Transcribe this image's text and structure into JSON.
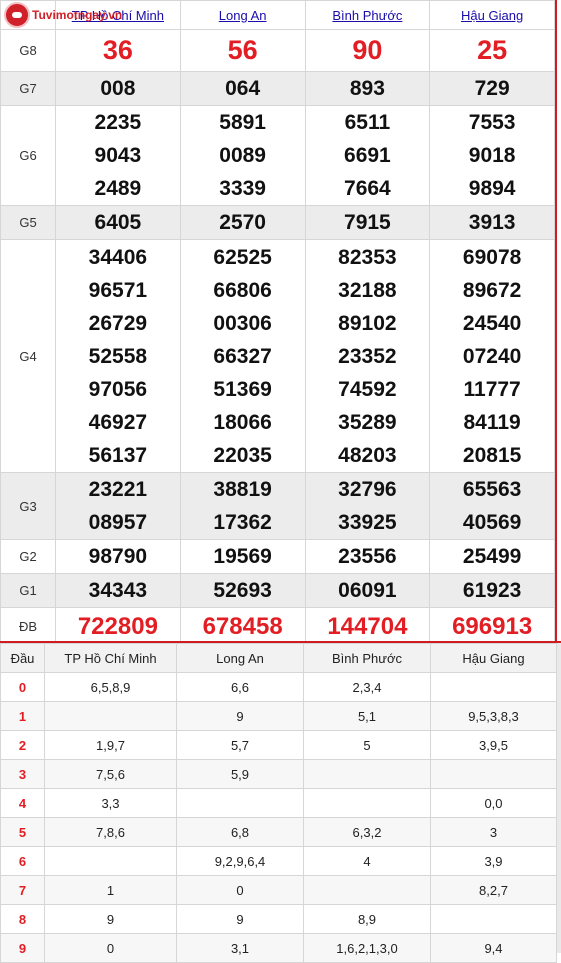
{
  "logo": {
    "text": "Tuvimotngay.vn"
  },
  "provinces": [
    "TP Hồ Chí Minh",
    "Long An",
    "Bình Phước",
    "Hậu Giang"
  ],
  "prize_labels": {
    "g8": "G8",
    "g7": "G7",
    "g6": "G6",
    "g5": "G5",
    "g4": "G4",
    "g3": "G3",
    "g2": "G2",
    "g1": "G1",
    "db": "ĐB"
  },
  "results": {
    "g8": [
      "36",
      "56",
      "90",
      "25"
    ],
    "g7": [
      "008",
      "064",
      "893",
      "729"
    ],
    "g6": [
      [
        "2235",
        "9043",
        "2489"
      ],
      [
        "5891",
        "0089",
        "3339"
      ],
      [
        "6511",
        "6691",
        "7664"
      ],
      [
        "7553",
        "9018",
        "9894"
      ]
    ],
    "g5": [
      "6405",
      "2570",
      "7915",
      "3913"
    ],
    "g4": [
      [
        "34406",
        "96571",
        "26729",
        "52558",
        "97056",
        "46927",
        "56137"
      ],
      [
        "62525",
        "66806",
        "00306",
        "66327",
        "51369",
        "18066",
        "22035"
      ],
      [
        "82353",
        "32188",
        "89102",
        "23352",
        "74592",
        "35289",
        "48203"
      ],
      [
        "69078",
        "89672",
        "24540",
        "07240",
        "11777",
        "84119",
        "20815"
      ]
    ],
    "g3": [
      [
        "23221",
        "08957"
      ],
      [
        "38819",
        "17362"
      ],
      [
        "32796",
        "33925"
      ],
      [
        "65563",
        "40569"
      ]
    ],
    "g2": [
      "98790",
      "19569",
      "23556",
      "25499"
    ],
    "g1": [
      "34343",
      "52693",
      "06091",
      "61923"
    ],
    "db": [
      "722809",
      "678458",
      "144704",
      "696913"
    ]
  },
  "loto": {
    "head_label": "Đầu",
    "columns": [
      "TP Hồ Chí Minh",
      "Long An",
      "Bình Phước",
      "Hậu Giang"
    ],
    "rows": [
      {
        "head": "0",
        "values": [
          "6,5,8,9",
          "6,6",
          "2,3,4",
          ""
        ]
      },
      {
        "head": "1",
        "values": [
          "",
          "9",
          "5,1",
          "9,5,3,8,3"
        ]
      },
      {
        "head": "2",
        "values": [
          "1,9,7",
          "5,7",
          "5",
          "3,9,5"
        ]
      },
      {
        "head": "3",
        "values": [
          "7,5,6",
          "5,9",
          "",
          ""
        ]
      },
      {
        "head": "4",
        "values": [
          "3,3",
          "",
          "",
          "0,0"
        ]
      },
      {
        "head": "5",
        "values": [
          "7,8,6",
          "6,8",
          "6,3,2",
          "3"
        ]
      },
      {
        "head": "6",
        "values": [
          "",
          "9,2,9,6,4",
          "4",
          "3,9"
        ]
      },
      {
        "head": "7",
        "values": [
          "1",
          "0",
          "",
          "8,2,7"
        ]
      },
      {
        "head": "8",
        "values": [
          "9",
          "9",
          "8,9",
          ""
        ]
      },
      {
        "head": "9",
        "values": [
          "0",
          "3,1",
          "1,6,2,1,3,0",
          "9,4"
        ]
      }
    ]
  },
  "colors": {
    "accent_red": "#e21d23",
    "link_blue": "#1a0dab",
    "alt_row": "#ececec"
  }
}
